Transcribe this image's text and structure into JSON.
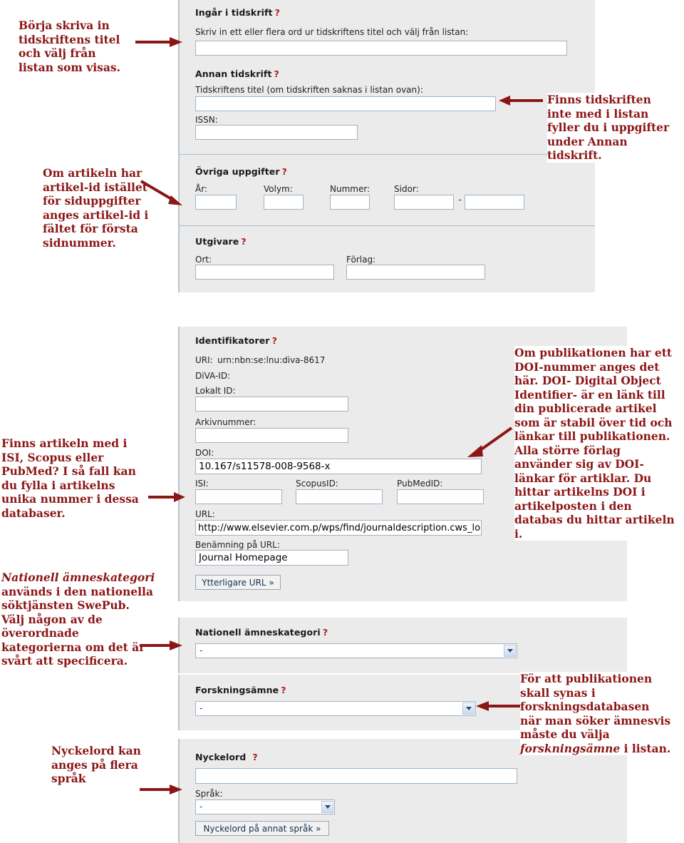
{
  "meta": {
    "accent_red": "#8c1616",
    "panel_bg": "#ebebeb",
    "field_border": "#9fb3c4"
  },
  "notes": {
    "n1": "Börja skriva in tidskriftens titel och välj från listan som visas.",
    "n2": "Om artikeln har artikel-id istället för siduppgifter anges artikel-id i fältet för första sidnummer.",
    "n3": "Finns tidskriften inte med i listan fyller du i uppgifter under Annan tidskrift.",
    "n4": "Finns artikeln med i ISI, Scopus eller PubMed? I så fall kan du fylla i artikelns unika nummer i dessa databaser.",
    "n5_a": "Nationell ämneskategori",
    "n5_b": " används i den nationella söktjänsten SwePub. Välj någon av de överordnade kategorierna om det är svårt att specificera.",
    "n6": "Nyckelord kan anges på flera språk",
    "n7": "Om publikationen har ett DOI-nummer anges det här. DOI- Digital Object Identifier- är en länk till din publicerade artikel som är stabil över tid och länkar till publikationen. Alla större förlag använder sig av DOI-länkar för artiklar. Du hittar artikelns DOI i artikelposten i den databas du hittar artikeln i.",
    "n8_a": "För att publikationen skall synas i forskningsdatabasen när man söker ämnesvis måste du välja ",
    "n8_b": "forskningsämne",
    "n8_c": " i listan."
  },
  "form_top": {
    "journal": {
      "legend": "Ingår i tidskrift",
      "q": "?",
      "hint": "Skriv in ett eller flera ord ur tidskriftens titel och välj från listan:",
      "input_value": ""
    },
    "other_journal": {
      "legend": "Annan tidskrift",
      "q": "?",
      "title_label": "Tidskriftens titel (om tidskriften saknas i listan ovan):",
      "title_value": "",
      "issn_label": "ISSN:",
      "issn_value": ""
    },
    "misc": {
      "legend": "Övriga uppgifter",
      "q": "?",
      "year_label": "År:",
      "year_value": "",
      "volume_label": "Volym:",
      "volume_value": "",
      "number_label": "Nummer:",
      "number_value": "",
      "pages_label": "Sidor:",
      "pages_from": "",
      "pages_sep": "-",
      "pages_to": ""
    },
    "publisher": {
      "legend": "Utgivare",
      "q": "?",
      "place_label": "Ort:",
      "place_value": "",
      "publisher_label": "Förlag:",
      "publisher_value": ""
    }
  },
  "form_bottom": {
    "identifiers": {
      "legend": "Identifikatorer",
      "q": "?",
      "uri_label": "URI:",
      "uri_value": "urn:nbn:se:lnu:diva-8617",
      "diva_label": "DiVA-ID:",
      "local_label": "Lokalt ID:",
      "local_value": "",
      "archive_label": "Arkivnummer:",
      "archive_value": "",
      "doi_label": "DOI:",
      "doi_value": "10.167/s11578-008-9568-x",
      "isi_label": "ISI:",
      "isi_value": "",
      "scopus_label": "ScopusID:",
      "scopus_value": "",
      "pubmed_label": "PubMedID:",
      "pubmed_value": "",
      "url_label": "URL:",
      "url_value": "http://www.elsevier.com.p/wps/find/journaldescription.cws_lo",
      "url_name_label": "Benämning på URL:",
      "url_name_value": "Journal Homepage",
      "more_url_button": "Ytterligare URL »"
    },
    "national_category": {
      "legend": "Nationell ämneskategori",
      "q": "?",
      "selected": "-"
    },
    "research_subject": {
      "legend": "Forskningsämne",
      "q": "?",
      "selected": "-"
    },
    "keywords": {
      "legend": "Nyckelord",
      "q": "?",
      "value": "",
      "lang_label": "Språk:",
      "lang_selected": "-",
      "other_lang_button": "Nyckelord på annat språk »"
    }
  }
}
